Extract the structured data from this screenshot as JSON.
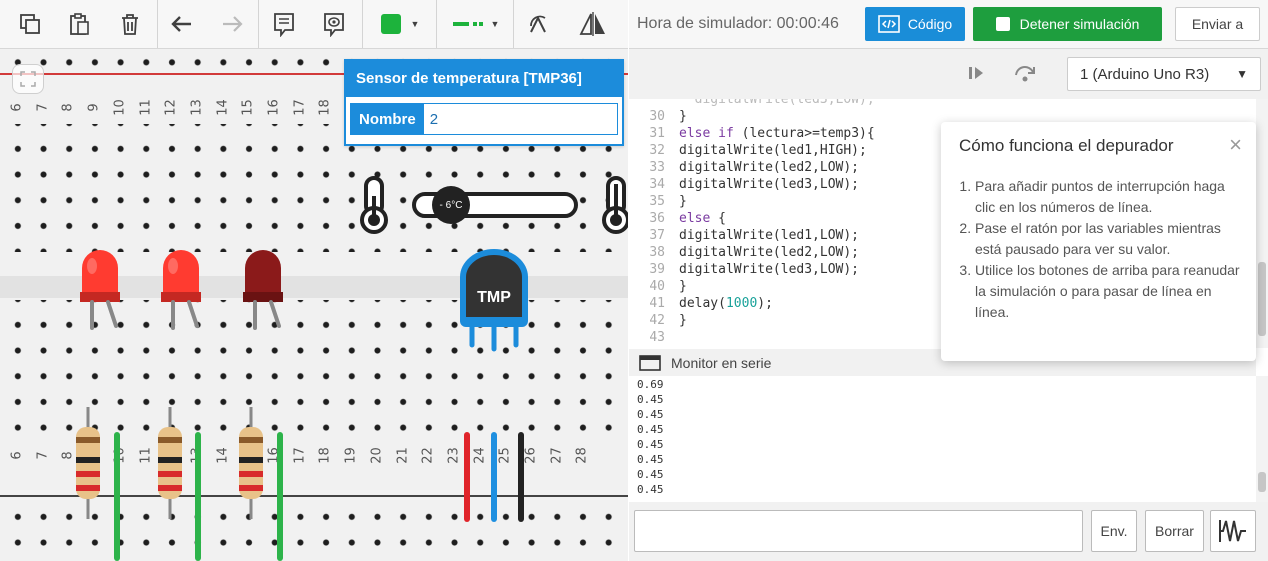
{
  "toolbar": {
    "icons": [
      "copy-icon",
      "paste-icon",
      "delete-icon",
      "undo-icon",
      "redo-icon",
      "notes-icon",
      "visibility-icon",
      "color-picker",
      "wire-style-picker",
      "rotate-icon",
      "flip-icon"
    ],
    "component_color": "#1db33c",
    "wire_color": "#1db33c"
  },
  "simulator": {
    "time_label": "Hora de simulador: 00:00:46",
    "code_label": "Código",
    "stop_label": "Detener simulación",
    "send_to_label": "Enviar a",
    "board_select": "1 (Arduino Uno R3)"
  },
  "board": {
    "top_col_numbers": [
      "6",
      "7",
      "8",
      "9",
      "10",
      "11",
      "12",
      "13",
      "14",
      "15",
      "16",
      "17",
      "18"
    ],
    "bottom_col_numbers": [
      "6",
      "7",
      "8",
      "9",
      "10",
      "11",
      "12",
      "13",
      "14",
      "15",
      "16",
      "17",
      "18",
      "19",
      "20",
      "21",
      "22",
      "23",
      "24",
      "25",
      "26",
      "27",
      "28"
    ],
    "slider_label": "- 6°C",
    "tmp_label": "TMP",
    "led_colors": [
      "#ff3b30",
      "#ff3b30",
      "#8b1a1a"
    ],
    "wire_colors": [
      "#2db34a",
      "#2db34a",
      "#2db34a",
      "#e0242a",
      "#1e8fe0",
      "#222222"
    ]
  },
  "sensor_popup": {
    "title": "Sensor de temperatura [TMP36]",
    "name_label": "Nombre",
    "name_value": "2"
  },
  "code": {
    "lines": [
      {
        "n": "30",
        "t": "}"
      },
      {
        "n": "31",
        "t": "else if (lectura>=temp3){"
      },
      {
        "n": "32",
        "t": "digitalWrite(led1,HIGH);"
      },
      {
        "n": "33",
        "t": "digitalWrite(led2,LOW);"
      },
      {
        "n": "34",
        "t": "digitalWrite(led3,LOW);"
      },
      {
        "n": "35",
        "t": "}"
      },
      {
        "n": "36",
        "t": "else {"
      },
      {
        "n": "37",
        "t": "digitalWrite(led1,LOW);"
      },
      {
        "n": "38",
        "t": "digitalWrite(led2,LOW);"
      },
      {
        "n": "39",
        "t": "digitalWrite(led3,LOW);"
      },
      {
        "n": "40",
        "t": "}"
      },
      {
        "n": "41",
        "t": "delay(1000);"
      },
      {
        "n": "42",
        "t": "}"
      },
      {
        "n": "43",
        "t": ""
      }
    ]
  },
  "debugger_tip": {
    "title": "Cómo funciona el depurador",
    "items": [
      "Para añadir puntos de interrupción haga clic en los números de línea.",
      "Pase el ratón por las variables mientras está pausado para ver su valor.",
      "Utilice los botones de arriba para reanudar la simulación o para pasar de línea en línea."
    ]
  },
  "serial_monitor": {
    "title": "Monitor en serie",
    "output": [
      "0.69",
      "0.45",
      "0.45",
      "0.45",
      "0.45",
      "0.45",
      "0.45",
      "0.45"
    ],
    "send_label": "Env.",
    "clear_label": "Borrar"
  }
}
